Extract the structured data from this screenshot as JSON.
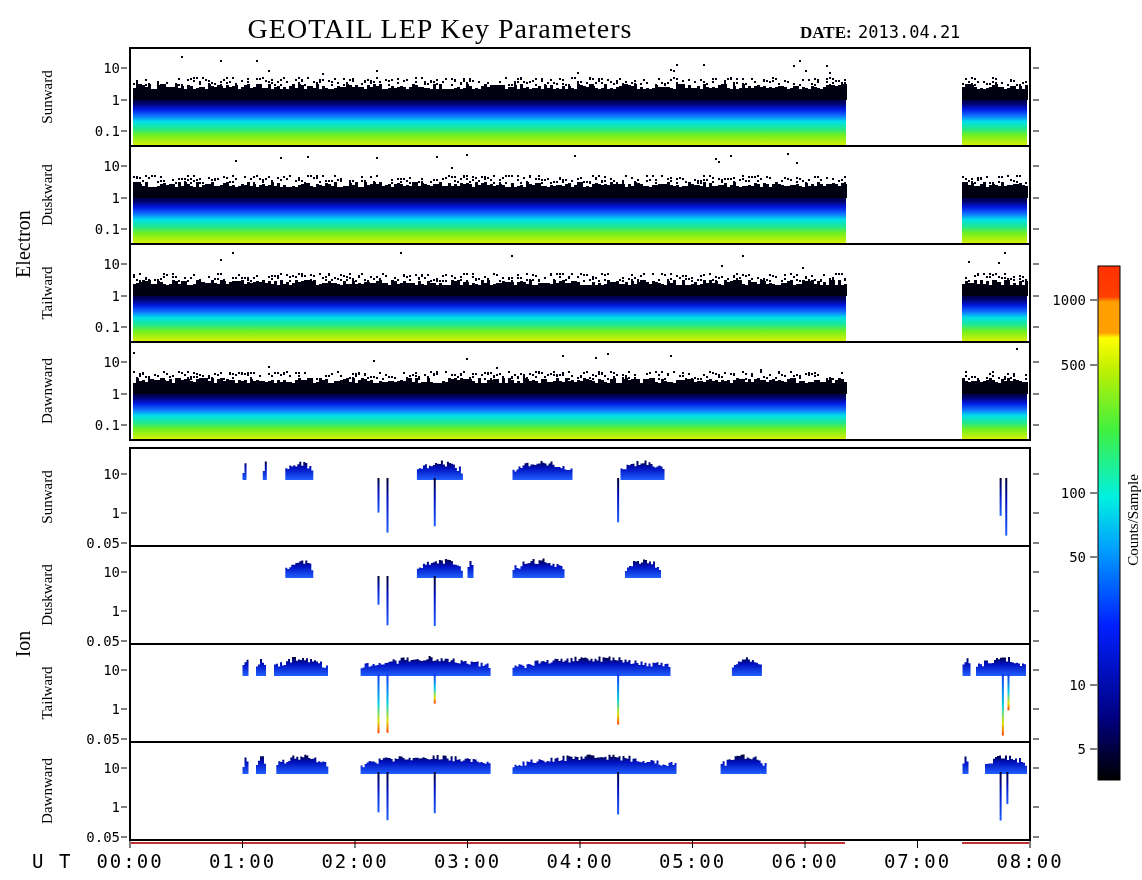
{
  "title": "GEOTAIL LEP Key Parameters",
  "date_label": "DATE:",
  "date": "2013.04.21",
  "groups": [
    {
      "label": "Electron",
      "kind": "electron",
      "panels": [
        {
          "label": "Sunward",
          "yticks": [
            "10",
            "1",
            "0.1"
          ]
        },
        {
          "label": "Duskward",
          "yticks": [
            "10",
            "1",
            "0.1"
          ]
        },
        {
          "label": "Tailward",
          "yticks": [
            "10",
            "1",
            "0.1"
          ]
        },
        {
          "label": "Dawnward",
          "yticks": [
            "10",
            "1",
            "0.1"
          ]
        }
      ]
    },
    {
      "label": "Ion",
      "kind": "ion",
      "panels": [
        {
          "label": "Sunward",
          "yticks": [
            "10",
            "1",
            "0.05"
          ]
        },
        {
          "label": "Duskward",
          "yticks": [
            "10",
            "1",
            "0.05"
          ]
        },
        {
          "label": "Tailward",
          "yticks": [
            "10",
            "1",
            "0.05"
          ]
        },
        {
          "label": "Dawnward",
          "yticks": [
            "10",
            "1",
            "0.05"
          ]
        }
      ]
    }
  ],
  "x_axis": {
    "label": "U T",
    "ticks": [
      "00:00",
      "01:00",
      "02:00",
      "03:00",
      "04:00",
      "05:00",
      "06:00",
      "07:00",
      "08:00"
    ]
  },
  "colorbar": {
    "label": "Counts/Sample",
    "ticks": [
      "1000",
      "500",
      "100",
      "50",
      "10",
      "5"
    ]
  }
}
